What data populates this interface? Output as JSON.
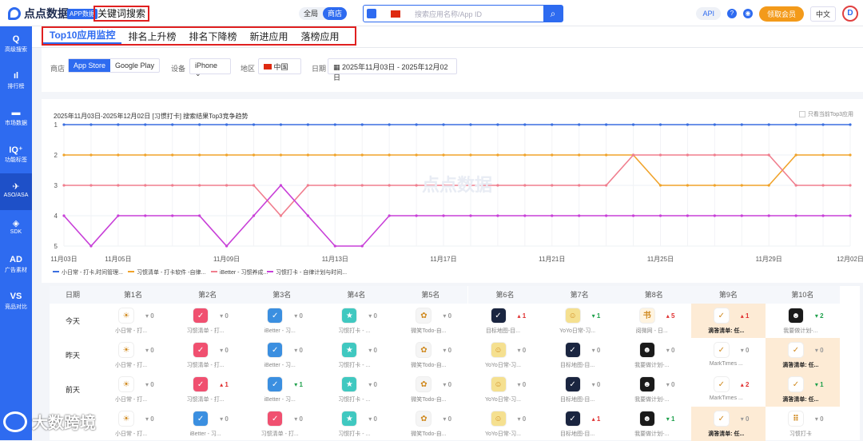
{
  "header": {
    "logo_text": "点点数据",
    "app_badge": "APP数据",
    "keyword_search": "关键词搜索",
    "scope": {
      "all": "全局",
      "store": "商店"
    },
    "search_placeholder": "搜索应用名称/App ID",
    "api": "API",
    "vip": "领取会员",
    "lang": "中文",
    "avatar": "D"
  },
  "sidebar": [
    {
      "icon": "Q",
      "label": "高级搜索"
    },
    {
      "icon": "ıl",
      "label": "排行榜"
    },
    {
      "icon": "▬",
      "label": "市场数据"
    },
    {
      "icon": "IQ⁺",
      "label": "功能标签"
    },
    {
      "icon": "✈",
      "label": "ASO/ASA",
      "active": true
    },
    {
      "icon": "◈",
      "label": "SDK"
    },
    {
      "icon": "AD",
      "label": "广告素材"
    },
    {
      "icon": "VS",
      "label": "竞品对比"
    }
  ],
  "tabs": [
    {
      "label": "Top10应用监控",
      "active": true
    },
    {
      "label": "排名上升榜"
    },
    {
      "label": "排名下降榜"
    },
    {
      "label": "新进应用"
    },
    {
      "label": "落榜应用"
    }
  ],
  "filters": {
    "store_label": "商店",
    "store_options": [
      "App Store",
      "Google Play"
    ],
    "device_label": "设备",
    "device_value": "iPhone",
    "region_label": "地区",
    "region_value": "中国",
    "date_label": "日期",
    "date_start": "2025年11月03日",
    "date_sep": "-",
    "date_end": "2025年12月02日"
  },
  "chart_title": "2025年11月03日-2025年12月02日 [习惯打卡] 搜索结果Top3竞争趋势",
  "chart_checkbox": "只看当前Top3应用",
  "chart_data": {
    "type": "line",
    "y_reversed": true,
    "ylim": [
      1,
      5
    ],
    "yticks": [
      "1",
      "2",
      "3",
      "4",
      "5"
    ],
    "x_ticks": [
      "11月03日",
      "11月05日",
      "11月09日",
      "11月13日",
      "11月17日",
      "11月21日",
      "11月25日",
      "11月29日",
      "12月02日"
    ],
    "x_days": [
      "11-03",
      "11-04",
      "11-05",
      "11-06",
      "11-07",
      "11-08",
      "11-09",
      "11-10",
      "11-11",
      "11-12",
      "11-13",
      "11-14",
      "11-15",
      "11-16",
      "11-17",
      "11-18",
      "11-19",
      "11-20",
      "11-21",
      "11-22",
      "11-23",
      "11-24",
      "11-25",
      "11-26",
      "11-27",
      "11-28",
      "11-29",
      "11-30",
      "12-01",
      "12-02"
    ],
    "series": [
      {
        "name": "小日常 - 打卡,时间管理...",
        "color": "#3b6fe0",
        "values": [
          1,
          1,
          1,
          1,
          1,
          1,
          1,
          1,
          1,
          1,
          1,
          1,
          1,
          1,
          1,
          1,
          1,
          1,
          1,
          1,
          1,
          1,
          1,
          1,
          1,
          1,
          1,
          1,
          1,
          1
        ]
      },
      {
        "name": "习惯清单 - 打卡软件 -自律...",
        "color": "#f0a32a",
        "values": [
          2,
          2,
          2,
          2,
          2,
          2,
          2,
          2,
          2,
          2,
          2,
          2,
          2,
          2,
          2,
          2,
          2,
          2,
          2,
          2,
          2,
          2,
          3,
          3,
          3,
          3,
          3,
          2,
          2,
          2
        ]
      },
      {
        "name": "iBetter - 习惯养成...",
        "color": "#f07e8e",
        "values": [
          3,
          3,
          3,
          3,
          3,
          3,
          3,
          3,
          4,
          3,
          3,
          3,
          3,
          3,
          3,
          3,
          3,
          3,
          3,
          3,
          3,
          2,
          2,
          2,
          2,
          2,
          2,
          3,
          3,
          3
        ]
      },
      {
        "name": "习惯打卡 - 自律计划与时间...",
        "color": "#c840d8",
        "values": [
          4,
          5,
          4,
          4,
          4,
          4,
          5,
          4,
          3,
          4,
          5,
          5,
          4,
          4,
          4,
          4,
          4,
          4,
          4,
          4,
          4,
          4,
          4,
          4,
          4,
          4,
          4,
          4,
          4,
          4
        ]
      }
    ]
  },
  "table": {
    "date_header": "日期",
    "rank_headers": [
      "第1名",
      "第2名",
      "第3名",
      "第4名",
      "第5名",
      "第6名",
      "第7名",
      "第8名",
      "第9名",
      "第10名"
    ],
    "rows": [
      {
        "date": "今天",
        "cells": [
          {
            "name": "小日常 - 打...",
            "icon": "☀",
            "color": "#ffffff",
            "chg": "0",
            "dir": "zero"
          },
          {
            "name": "习惯清单 - 打...",
            "icon": "✓",
            "color": "#f05070",
            "chg": "0",
            "dir": "zero"
          },
          {
            "name": "iBetter - 习...",
            "icon": "✓",
            "color": "#3b8fe0",
            "chg": "0",
            "dir": "zero"
          },
          {
            "name": "习惯打卡 - ...",
            "icon": "★",
            "color": "#40c8c0",
            "chg": "0",
            "dir": "zero"
          },
          {
            "name": "微笑Todo-自...",
            "icon": "✿",
            "color": "#f5f5f5",
            "chg": "0",
            "dir": "zero"
          },
          {
            "name": "目标地图-目...",
            "icon": "✓",
            "color": "#1a2540",
            "chg": "1",
            "dir": "up"
          },
          {
            "name": "YoYo日常-习...",
            "icon": "☺",
            "color": "#f5e090",
            "chg": "1",
            "dir": "down"
          },
          {
            "name": "阅微网 - 日...",
            "icon": "书",
            "color": "#fff4e0",
            "chg": "5",
            "dir": "up"
          },
          {
            "name": "滴答清单: 任...",
            "icon": "✓",
            "color": "#ffffff",
            "chg": "1",
            "dir": "up",
            "hl": true
          },
          {
            "name": "我要做计划-...",
            "icon": "☻",
            "color": "#1a1a1a",
            "chg": "2",
            "dir": "down"
          }
        ]
      },
      {
        "date": "昨天",
        "cells": [
          {
            "name": "小日常 - 打...",
            "icon": "☀",
            "color": "#ffffff",
            "chg": "0",
            "dir": "zero"
          },
          {
            "name": "习惯清单 - 打...",
            "icon": "✓",
            "color": "#f05070",
            "chg": "0",
            "dir": "zero"
          },
          {
            "name": "iBetter - 习...",
            "icon": "✓",
            "color": "#3b8fe0",
            "chg": "0",
            "dir": "zero"
          },
          {
            "name": "习惯打卡 - ...",
            "icon": "★",
            "color": "#40c8c0",
            "chg": "0",
            "dir": "zero"
          },
          {
            "name": "微笑Todo-自...",
            "icon": "✿",
            "color": "#f5f5f5",
            "chg": "0",
            "dir": "zero"
          },
          {
            "name": "YoYo日常-习...",
            "icon": "☺",
            "color": "#f5e090",
            "chg": "0",
            "dir": "zero"
          },
          {
            "name": "目标地图-目...",
            "icon": "✓",
            "color": "#1a2540",
            "chg": "0",
            "dir": "zero"
          },
          {
            "name": "我要做计划-...",
            "icon": "☻",
            "color": "#1a1a1a",
            "chg": "0",
            "dir": "zero"
          },
          {
            "name": "MarkTimes ...",
            "icon": "✓",
            "color": "#ffffff",
            "chg": "0",
            "dir": "zero"
          },
          {
            "name": "滴答清单: 任...",
            "icon": "✓",
            "color": "#ffffff",
            "chg": "0",
            "dir": "zero",
            "hl": true
          }
        ]
      },
      {
        "date": "前天",
        "cells": [
          {
            "name": "小日常 - 打...",
            "icon": "☀",
            "color": "#ffffff",
            "chg": "0",
            "dir": "zero"
          },
          {
            "name": "习惯清单 - 打...",
            "icon": "✓",
            "color": "#f05070",
            "chg": "1",
            "dir": "up"
          },
          {
            "name": "iBetter - 习...",
            "icon": "✓",
            "color": "#3b8fe0",
            "chg": "1",
            "dir": "down"
          },
          {
            "name": "习惯打卡 - ...",
            "icon": "★",
            "color": "#40c8c0",
            "chg": "0",
            "dir": "zero"
          },
          {
            "name": "微笑Todo-自...",
            "icon": "✿",
            "color": "#f5f5f5",
            "chg": "0",
            "dir": "zero"
          },
          {
            "name": "YoYo日常-习...",
            "icon": "☺",
            "color": "#f5e090",
            "chg": "0",
            "dir": "zero"
          },
          {
            "name": "目标地图-目...",
            "icon": "✓",
            "color": "#1a2540",
            "chg": "0",
            "dir": "zero"
          },
          {
            "name": "我要做计划-...",
            "icon": "☻",
            "color": "#1a1a1a",
            "chg": "0",
            "dir": "zero"
          },
          {
            "name": "MarkTimes ...",
            "icon": "✓",
            "color": "#ffffff",
            "chg": "2",
            "dir": "up"
          },
          {
            "name": "滴答清单: 任...",
            "icon": "✓",
            "color": "#ffffff",
            "chg": "1",
            "dir": "down",
            "hl": true
          }
        ]
      },
      {
        "date": "",
        "cells": [
          {
            "name": "小日常 - 打...",
            "icon": "☀",
            "color": "#ffffff",
            "chg": "0",
            "dir": "zero"
          },
          {
            "name": "iBetter - 习...",
            "icon": "✓",
            "color": "#3b8fe0",
            "chg": "0",
            "dir": "zero"
          },
          {
            "name": "习惯清单 - 打...",
            "icon": "✓",
            "color": "#f05070",
            "chg": "0",
            "dir": "zero"
          },
          {
            "name": "习惯打卡 - ...",
            "icon": "★",
            "color": "#40c8c0",
            "chg": "0",
            "dir": "zero"
          },
          {
            "name": "微笑Todo-自...",
            "icon": "✿",
            "color": "#f5f5f5",
            "chg": "0",
            "dir": "zero"
          },
          {
            "name": "YoYo日常-习...",
            "icon": "☺",
            "color": "#f5e090",
            "chg": "0",
            "dir": "zero"
          },
          {
            "name": "目标地图-目...",
            "icon": "✓",
            "color": "#1a2540",
            "chg": "1",
            "dir": "up"
          },
          {
            "name": "我要做计划-...",
            "icon": "☻",
            "color": "#1a1a1a",
            "chg": "1",
            "dir": "down"
          },
          {
            "name": "滴答清单: 任...",
            "icon": "✓",
            "color": "#ffffff",
            "chg": "0",
            "dir": "zero",
            "hl": true
          },
          {
            "name": "习惯打卡",
            "icon": "⠿",
            "color": "#ffffff",
            "chg": "0",
            "dir": "zero"
          }
        ]
      }
    ]
  },
  "watermark": "大数跨境"
}
